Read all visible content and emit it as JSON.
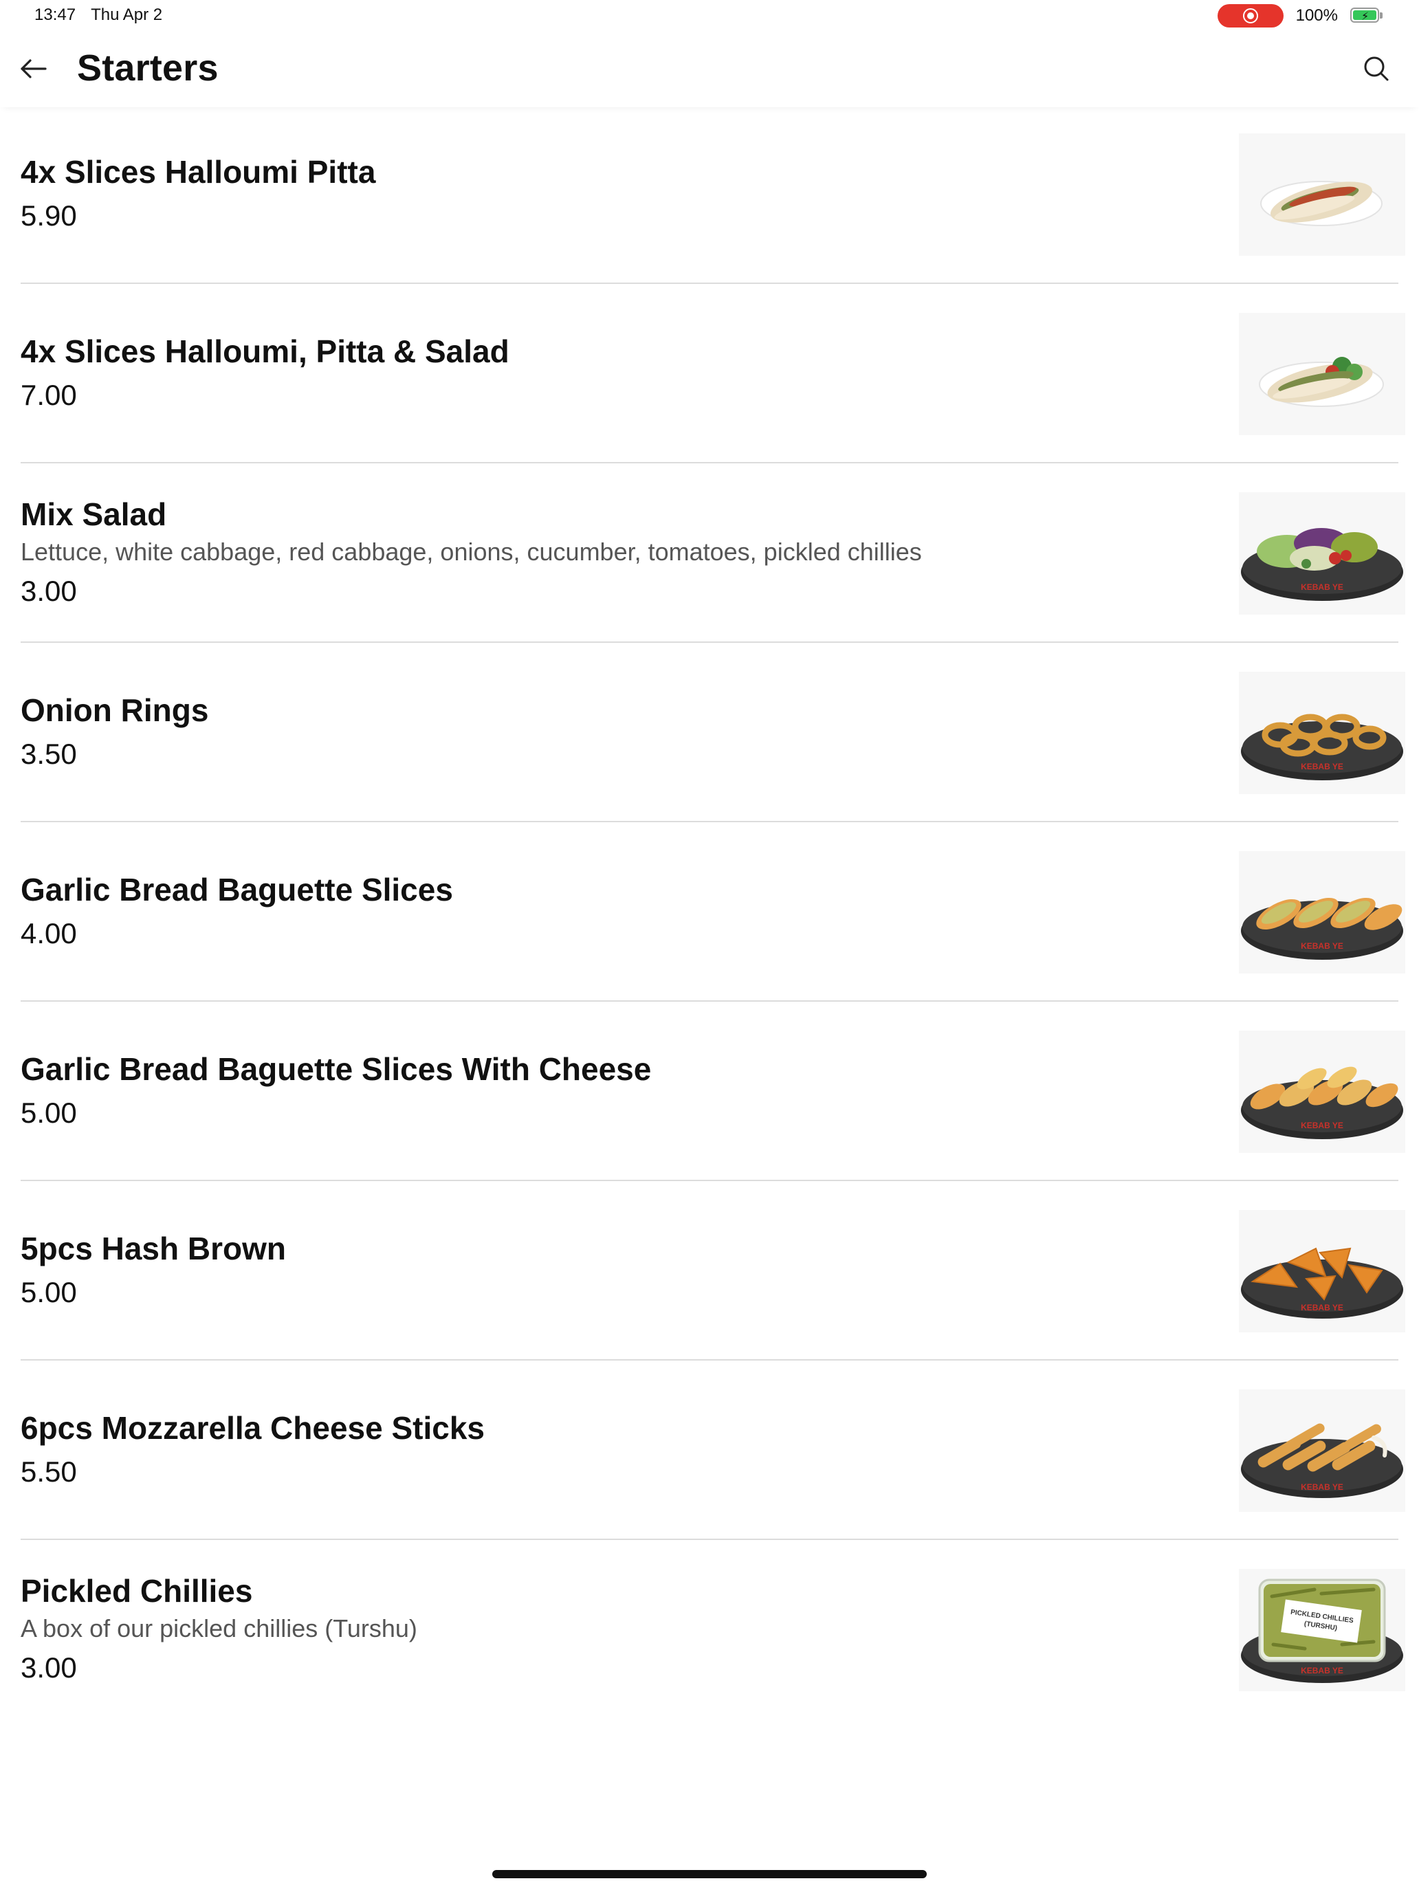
{
  "status": {
    "time": "13:47",
    "date": "Thu Apr 2",
    "battery": "100%",
    "battery_level": 1.0,
    "recording": true,
    "accent_color": "#e5342b"
  },
  "header": {
    "title": "Starters",
    "back_icon": "arrow-left-icon",
    "search_icon": "search-icon"
  },
  "items": [
    {
      "name": "4x Slices Halloumi Pitta",
      "description": "",
      "price": "5.90",
      "thumb": "halloumi-pitta"
    },
    {
      "name": "4x Slices Halloumi, Pitta & Salad",
      "description": "",
      "price": "7.00",
      "thumb": "halloumi-pitta-salad"
    },
    {
      "name": "Mix Salad",
      "description": "Lettuce, white cabbage, red cabbage, onions, cucumber, tomatoes, pickled chillies",
      "price": "3.00",
      "thumb": "mix-salad"
    },
    {
      "name": "Onion Rings",
      "description": "",
      "price": "3.50",
      "thumb": "onion-rings"
    },
    {
      "name": "Garlic Bread Baguette Slices",
      "description": "",
      "price": "4.00",
      "thumb": "garlic-bread"
    },
    {
      "name": "Garlic Bread Baguette Slices With Cheese",
      "description": "",
      "price": "5.00",
      "thumb": "garlic-bread-cheese"
    },
    {
      "name": "5pcs Hash Brown",
      "description": "",
      "price": "5.00",
      "thumb": "hash-brown"
    },
    {
      "name": "6pcs Mozzarella Cheese Sticks",
      "description": "",
      "price": "5.50",
      "thumb": "mozzarella-sticks"
    },
    {
      "name": "Pickled Chillies",
      "description": "A box of our pickled chillies (Turshu)",
      "price": "3.00",
      "thumb": "pickled-chillies"
    }
  ],
  "plate_label": "KEBAB YE",
  "box_label_1": "PICKLED CHILLIES",
  "box_label_2": "(TURSHU)"
}
